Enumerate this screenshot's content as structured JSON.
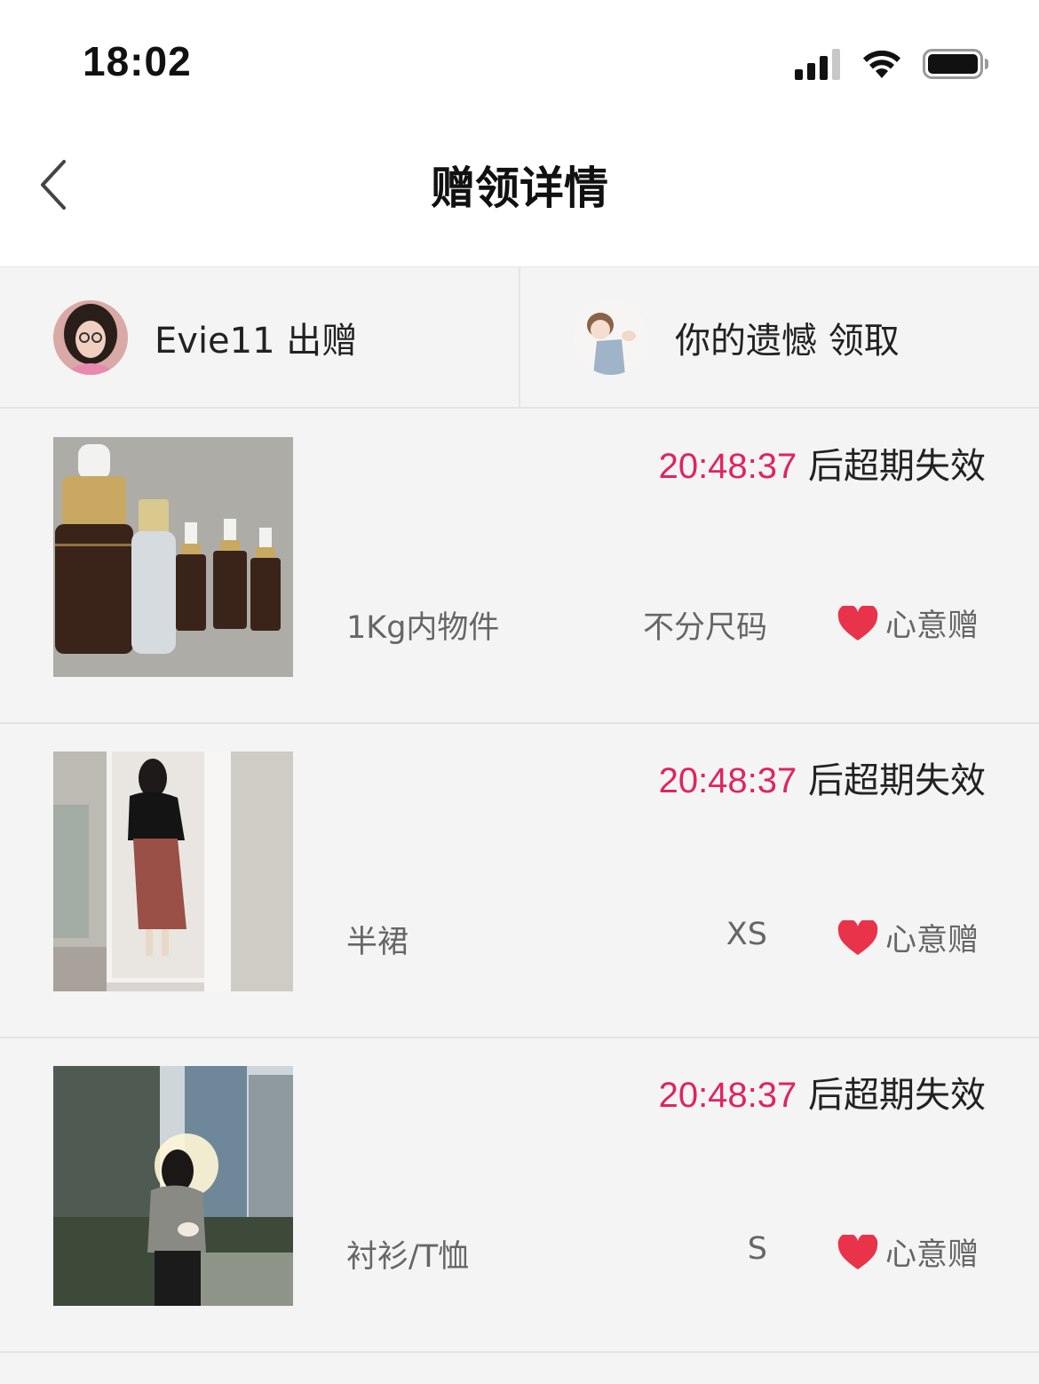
{
  "status_bar": {
    "time": "18:02"
  },
  "nav": {
    "title": "赠领详情"
  },
  "parties": {
    "giver": {
      "label": "Evie11 出赠"
    },
    "receiver": {
      "label": "你的遗憾 领取"
    }
  },
  "items": [
    {
      "timer": "20:48:37",
      "timer_suffix": "后超期失效",
      "name": "1Kg内物件",
      "size": "不分尺码",
      "tag": "心意赠"
    },
    {
      "timer": "20:48:37",
      "timer_suffix": "后超期失效",
      "name": "半裙",
      "size": "XS",
      "tag": "心意赠"
    },
    {
      "timer": "20:48:37",
      "timer_suffix": "后超期失效",
      "name": "衬衫/T恤",
      "size": "S",
      "tag": "心意赠"
    }
  ],
  "colors": {
    "accent": "#e0245e",
    "background": "#f4f4f4"
  }
}
